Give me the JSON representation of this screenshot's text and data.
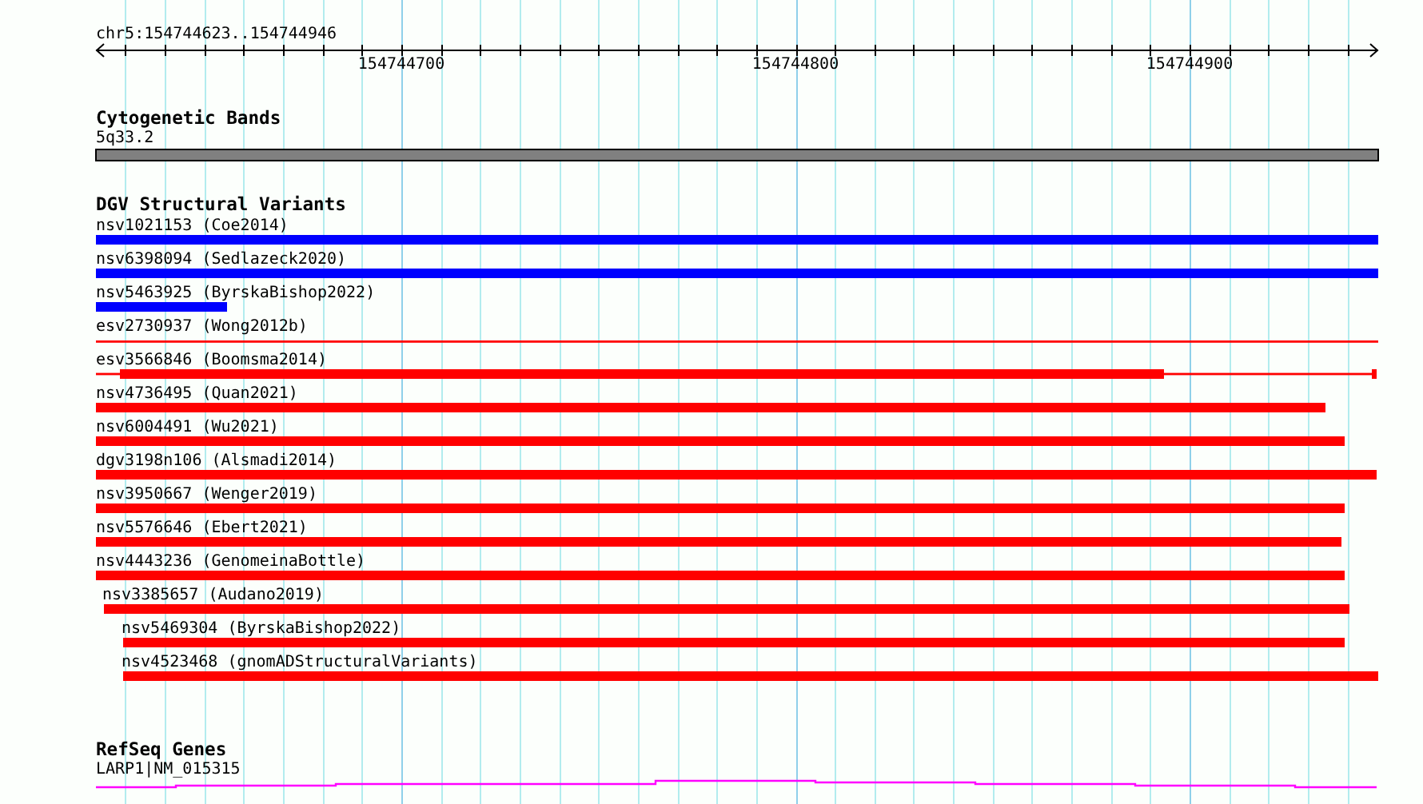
{
  "ruler": {
    "range": "chr5:154744623..154744946",
    "tick_labels": [
      "154744700",
      "154744800",
      "154744900"
    ]
  },
  "tracks": [
    {
      "kind": "cytoband",
      "title": "Cytogenetic Bands",
      "features": [
        {
          "label": "5q33.2"
        }
      ]
    },
    {
      "kind": "variants",
      "title": "DGV Structural Variants",
      "features": [
        {
          "label": "nsv1021153 (Coe2014)",
          "color": "#0000ff"
        },
        {
          "label": "nsv6398094 (Sedlazeck2020)",
          "color": "#0000ff"
        },
        {
          "label": "nsv5463925 (ByrskaBishop2022)",
          "color": "#0000ff"
        },
        {
          "label": "esv2730937 (Wong2012b)",
          "color": "#ff0000"
        },
        {
          "label": "esv3566846 (Boomsma2014)",
          "color": "#ff0000"
        },
        {
          "label": "nsv4736495 (Quan2021)",
          "color": "#ff0000"
        },
        {
          "label": "nsv6004491 (Wu2021)",
          "color": "#ff0000"
        },
        {
          "label": "dgv3198n106 (Alsmadi2014)",
          "color": "#ff0000"
        },
        {
          "label": "nsv3950667 (Wenger2019)",
          "color": "#ff0000"
        },
        {
          "label": "nsv5576646 (Ebert2021)",
          "color": "#ff0000"
        },
        {
          "label": "nsv4443236 (GenomeinaBottle)",
          "color": "#ff0000"
        },
        {
          "label": "nsv3385657 (Audano2019)",
          "color": "#ff0000"
        },
        {
          "label": "nsv5469304 (ByrskaBishop2022)",
          "color": "#ff0000"
        },
        {
          "label": "nsv4523468 (gnomADStructuralVariants)",
          "color": "#ff0000"
        }
      ]
    },
    {
      "kind": "genes",
      "title": "RefSeq Genes",
      "features": [
        {
          "label": "LARP1|NM_015315"
        }
      ]
    }
  ]
}
